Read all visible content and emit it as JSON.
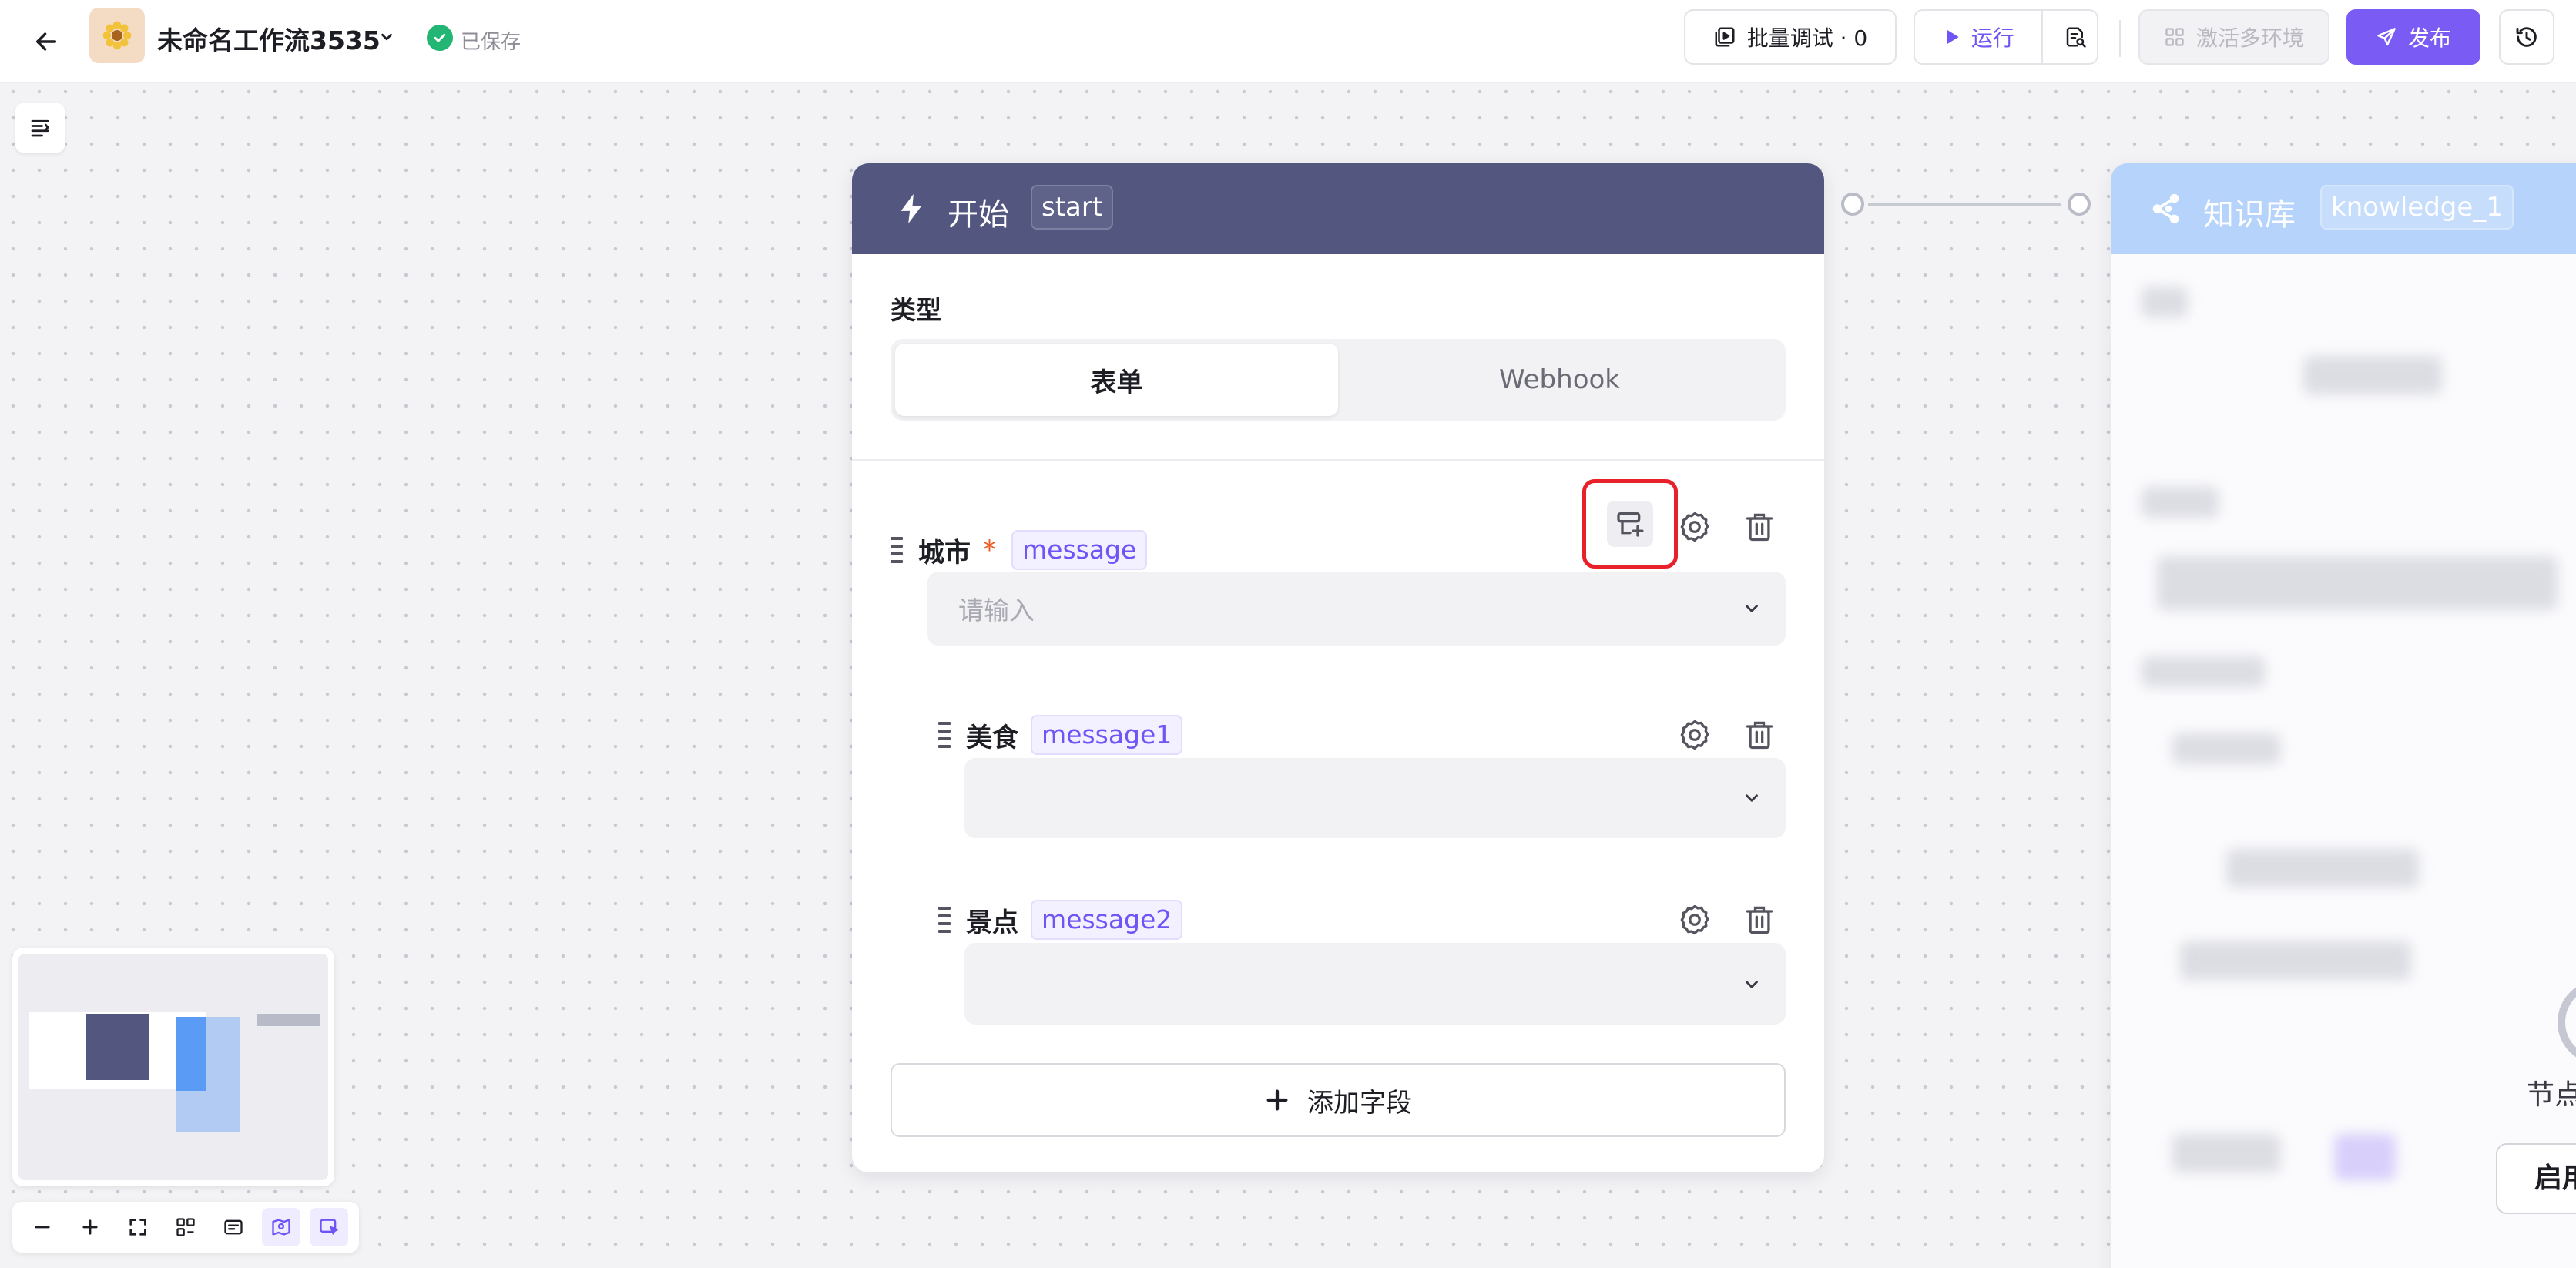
{
  "header": {
    "app_title": "未命名工作流3535",
    "saved_status": "已保存",
    "batch_debug_label": "批量调试 · 0",
    "run_label": "运行",
    "activate_env_label": "激活多环境",
    "publish_label": "发布"
  },
  "start_node": {
    "title": "开始",
    "tag": "start",
    "type_label": "类型",
    "type_options": [
      "表单",
      "Webhook"
    ],
    "selected_type": "表单",
    "fields": [
      {
        "label": "城市",
        "required": true,
        "variable": "message",
        "placeholder": "请输入"
      },
      {
        "label": "美食",
        "required": false,
        "variable": "message1",
        "placeholder": ""
      },
      {
        "label": "景点",
        "required": false,
        "variable": "message2",
        "placeholder": ""
      }
    ],
    "add_field_label": "添加字段",
    "required_marker": "*"
  },
  "knowledge_node": {
    "title": "知识库",
    "tag": "knowledge_1",
    "partial_text": "节点",
    "partial_button": "启用"
  },
  "colors": {
    "accent": "#7a5cf5",
    "start_header": "#535780",
    "knowledge_header": "#b6d3fb",
    "highlight": "#e8202a",
    "saved_green": "#22b573"
  },
  "icons": {
    "back": "arrow-left-icon",
    "app": "sun-flower-icon",
    "saved": "check-circle-icon",
    "run": "play-icon",
    "publish": "send-icon",
    "history": "history-icon",
    "start": "bolt-icon",
    "knowledge": "share-nodes-icon"
  }
}
